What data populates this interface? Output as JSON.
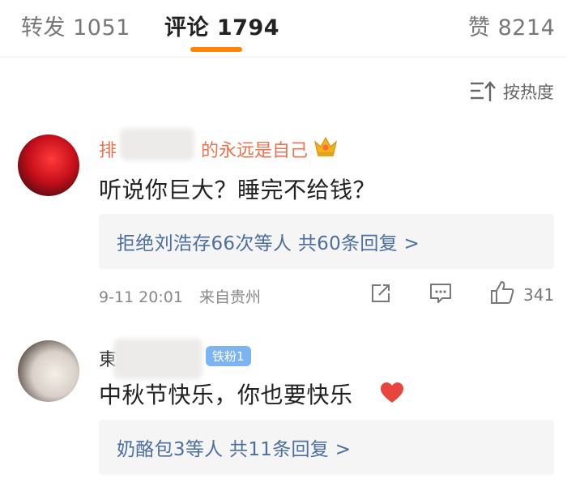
{
  "tabs": [
    {
      "label": "转发 1051"
    },
    {
      "label": "评论 1794"
    },
    {
      "label": "赞 8214"
    }
  ],
  "sort": {
    "label": "按热度",
    "icon": "sort-icon"
  },
  "comments": [
    {
      "username": "排■■■■的永远是自己",
      "username_visible_prefix": "排",
      "username_visible_suffix": "的永远是自己",
      "text": "听说你巨大？睡完不给钱？",
      "replies": "拒绝刘浩存66次等人 共60条回复 >",
      "time": "9-11 20:01",
      "location": "来自贵州",
      "likes": "341"
    },
    {
      "username_visible_prefix": "東",
      "fan_badge": "铁粉1",
      "text": "中秋节快乐，你也要快乐",
      "replies": "奶酪包3等人 共11条回复 >"
    }
  ],
  "colors": {
    "accent": "#ff8200",
    "link": "#4c6ea0",
    "vip_name": "#eb7350",
    "fan_badge": "#7cb3f3"
  }
}
